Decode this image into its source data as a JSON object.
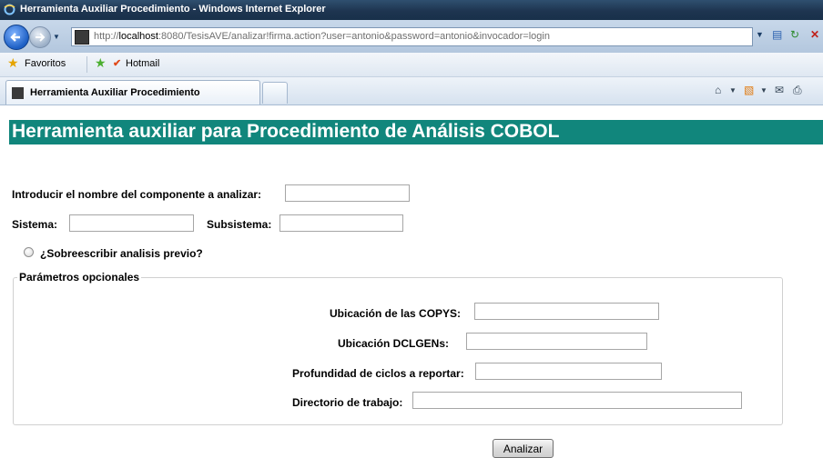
{
  "window": {
    "title": "Herramienta Auxiliar Procedimiento - Windows Internet Explorer"
  },
  "address_bar": {
    "url_prefix": "http://",
    "url_host": "localhost",
    "url_rest": ":8080/TesisAVE/analizar!firma.action?user=antonio&password=antonio&invocador=login"
  },
  "favorites_bar": {
    "favorites_label": "Favoritos",
    "hotmail_label": "Hotmail"
  },
  "tab": {
    "label": "Herramienta Auxiliar Procedimiento"
  },
  "page": {
    "title": "Herramienta auxiliar para Procedimiento de Análisis COBOL",
    "componente_label": "Introducir el nombre del componente a analizar:",
    "componente_value": "",
    "sistema_label": "Sistema:",
    "sistema_value": "",
    "subsistema_label": "Subsistema:",
    "subsistema_value": "",
    "sobreescribir_label": "¿Sobreescribir analisis previo?",
    "sobreescribir_checked": false,
    "params_legend": "Parámetros opcionales",
    "copys_label": "Ubicación de las COPYS:",
    "copys_value": "",
    "dclgens_label": "Ubicación DCLGENs:",
    "dclgens_value": "",
    "profundidad_label": "Profundidad de ciclos a reportar:",
    "profundidad_value": "",
    "directorio_label": "Directorio de trabajo:",
    "directorio_value": "",
    "submit_label": "Analizar"
  },
  "colors": {
    "title_bg": "#11867c",
    "title_fg": "#ffffff"
  }
}
